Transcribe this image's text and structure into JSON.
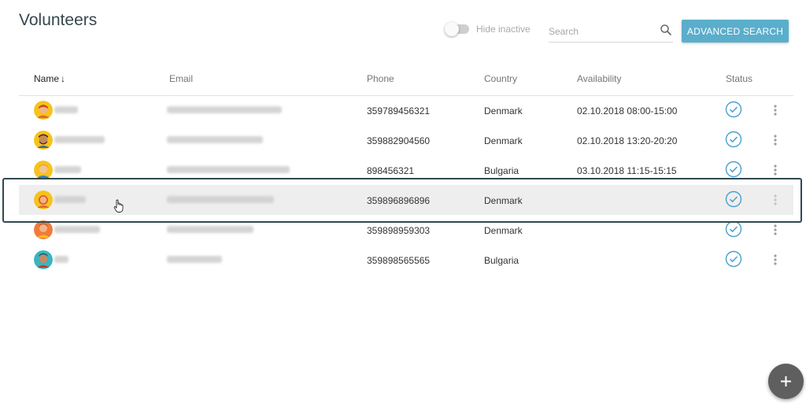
{
  "header": {
    "title": "Volunteers",
    "hide_inactive_label": "Hide inactive",
    "search_placeholder": "Search",
    "advanced_search_label": "ADVANCED SEARCH"
  },
  "table": {
    "columns": {
      "name": "Name",
      "email": "Email",
      "phone": "Phone",
      "country": "Country",
      "availability": "Availability",
      "status": "Status"
    },
    "sort_arrow": "↓",
    "rows": [
      {
        "phone": "359789456321",
        "country": "Denmark",
        "availability": "02.10.2018 08:00-15:00"
      },
      {
        "phone": "359882904560",
        "country": "Denmark",
        "availability": "02.10.2018 13:20-20:20"
      },
      {
        "phone": "898456321",
        "country": "Bulgaria",
        "availability": "03.10.2018 11:15-15:15"
      },
      {
        "phone": "359896896896",
        "country": "Denmark",
        "availability": ""
      },
      {
        "phone": "359898959303",
        "country": "Denmark",
        "availability": ""
      },
      {
        "phone": "359898565565",
        "country": "Bulgaria",
        "availability": ""
      }
    ]
  },
  "fab": {
    "label": "+"
  },
  "colors": {
    "accent": "#5aaecb",
    "status_check": "#4a9fce",
    "selection_frame": "#2f4a50",
    "fab": "#5f5f5f"
  }
}
